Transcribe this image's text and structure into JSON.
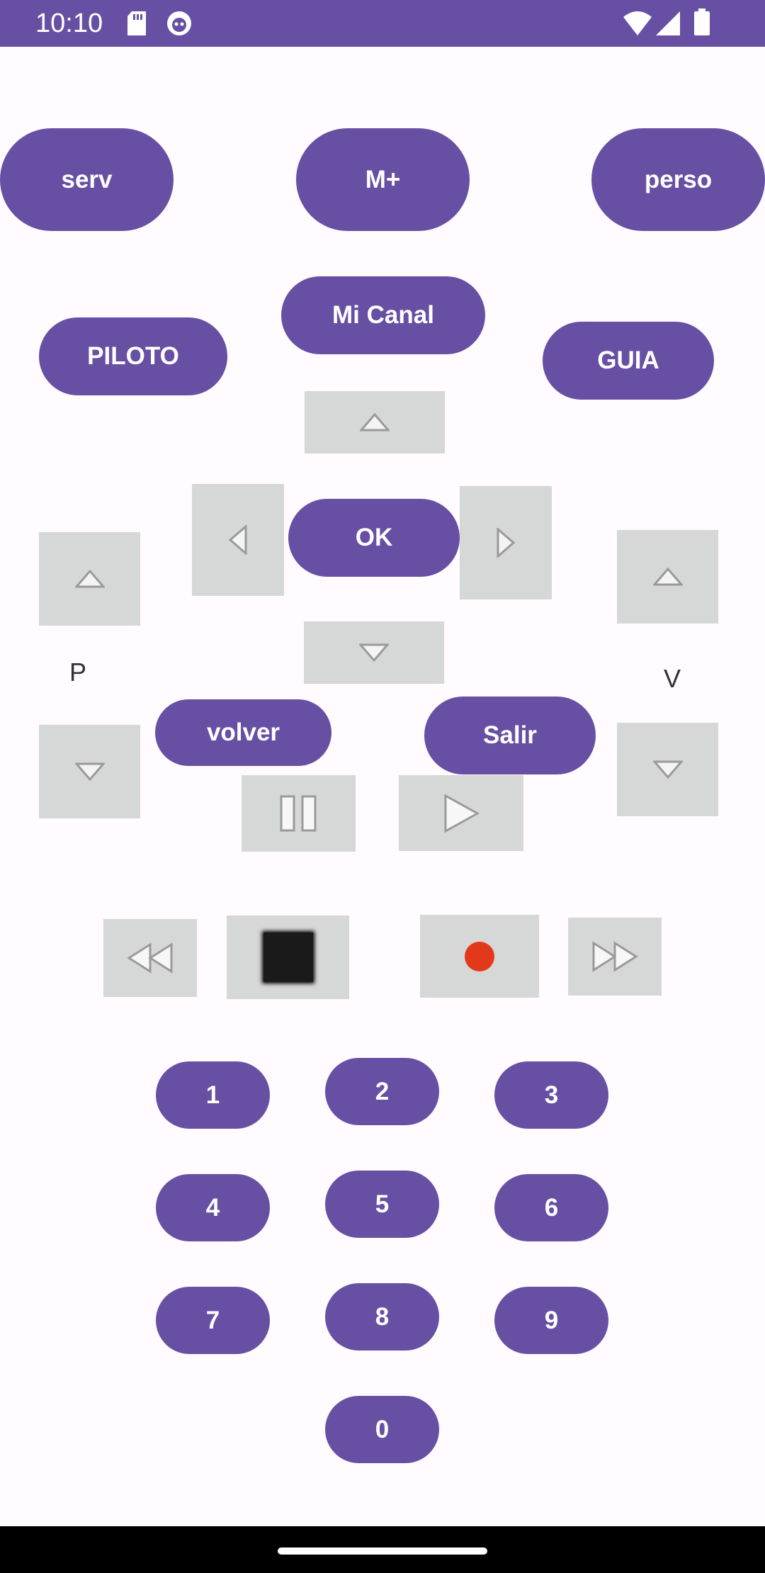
{
  "status_bar": {
    "time": "10:10",
    "icons": [
      "sd-card-icon",
      "android-debug-icon",
      "wifi-icon",
      "cell-signal-icon",
      "battery-icon"
    ]
  },
  "top_row": {
    "serv": "serv",
    "mplus": "M+",
    "perso": "perso"
  },
  "second_row": {
    "piloto": "PILOTO",
    "mi_canal": "Mi Canal",
    "guia": "GUIA"
  },
  "dpad": {
    "ok": "OK"
  },
  "side_labels": {
    "program": "P",
    "volume": "V"
  },
  "actions": {
    "volver": "volver",
    "salir": "Salir"
  },
  "media_icons": [
    "pause-icon",
    "play-icon",
    "rewind-icon",
    "stop-icon",
    "record-icon",
    "fast-forward-icon"
  ],
  "numpad": [
    "1",
    "2",
    "3",
    "4",
    "5",
    "6",
    "7",
    "8",
    "9",
    "0"
  ],
  "colors": {
    "accent": "#6750A4",
    "button_gray": "#D6D7D7",
    "record": "#E2391B",
    "background": "#FFFBFE"
  }
}
